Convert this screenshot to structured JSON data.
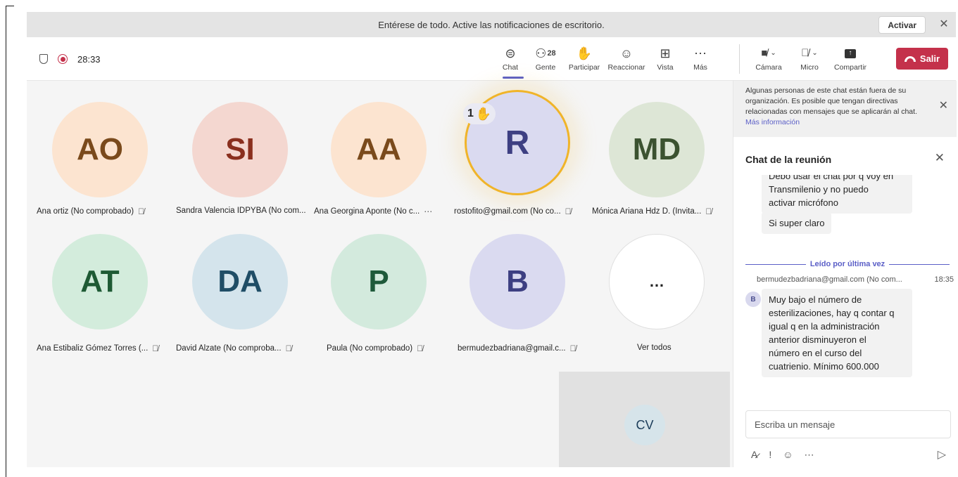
{
  "notification": {
    "text": "Entérese de todo. Active las notificaciones de escritorio.",
    "activate_label": "Activar"
  },
  "toolbar": {
    "timer": "28:33",
    "items": [
      {
        "label": "Chat",
        "icon": "chat-icon",
        "glyph": "⊜"
      },
      {
        "label": "Gente",
        "icon": "people-icon",
        "glyph": "⚇",
        "count": "28"
      },
      {
        "label": "Participar",
        "icon": "hand-icon",
        "glyph": "✋"
      },
      {
        "label": "Reaccionar",
        "icon": "smile-icon",
        "glyph": "☺"
      },
      {
        "label": "Vista",
        "icon": "grid-icon",
        "glyph": "⊞"
      },
      {
        "label": "Más",
        "icon": "more-icon",
        "glyph": "⋯"
      }
    ],
    "camera_label": "Cámara",
    "mic_label": "Micro",
    "share_label": "Compartir",
    "leave_label": "Salir"
  },
  "participants": [
    {
      "initials": "AO",
      "name": "Ana ortiz (No comprobado)",
      "bg": "#fce4d0",
      "fg": "#7a4a1c"
    },
    {
      "initials": "SI",
      "name": "Sandra Valencia IDPYBA (No com...",
      "bg": "#f4d7d0",
      "fg": "#8a2f1e"
    },
    {
      "initials": "AA",
      "name": "Ana Georgina Aponte (No c...",
      "bg": "#fce4d0",
      "fg": "#7a4a1c"
    },
    {
      "initials": "R",
      "name": "rostofito@gmail.com (No co...",
      "bg": "#dadaf0",
      "fg": "#3d3f82",
      "hand": "1"
    },
    {
      "initials": "MD",
      "name": "Mónica Ariana Hdz D. (Invita...",
      "bg": "#dde6d6",
      "fg": "#3b5230"
    },
    {
      "initials": "AT",
      "name": "Ana Estibaliz Gómez Torres (...",
      "bg": "#d3ecdc",
      "fg": "#1e5a34"
    },
    {
      "initials": "DA",
      "name": "David Alzate (No comproba...",
      "bg": "#d4e4ec",
      "fg": "#1f4d66"
    },
    {
      "initials": "P",
      "name": "Paula (No comprobado)",
      "bg": "#d3eadd",
      "fg": "#1e5a3a"
    },
    {
      "initials": "B",
      "name": "bermudezbadriana@gmail.c...",
      "bg": "#dadaf0",
      "fg": "#3d3f82"
    },
    {
      "initials": "…",
      "name": "Ver todos",
      "bg": "#ffffff",
      "fg": "#242424"
    }
  ],
  "self_view": {
    "initials": "CV"
  },
  "chat": {
    "external_notice": "Algunas personas de este chat están fuera de su organización. Es posible que tengan directivas relacionadas con mensajes que se aplicarán al chat.",
    "more_info": "Más información",
    "title": "Chat de la reunión",
    "msg1_line0": "Debo usar el chat por q voy en",
    "msg1_line1": "Transmilenio y no puedo",
    "msg1_line2": "activar micrófono",
    "msg2": "Si super claro",
    "last_read": "Leído por última vez",
    "sender": "bermudezbadriana@gmail.com (No com...",
    "time": "18:35",
    "sender_initial": "B",
    "msg3_lines": [
      "Muy bajo el número de",
      "esterilizaciones, hay q contar q",
      "igual q en la administración",
      "anterior disminuyeron el",
      "número en el curso del",
      "cuatrienio.  Mínimo 600.000"
    ],
    "compose_placeholder": "Escriba un mensaje"
  }
}
